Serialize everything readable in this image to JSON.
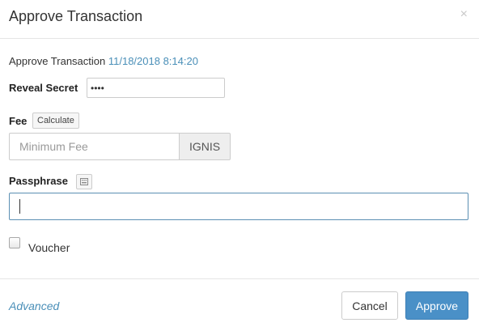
{
  "dialog": {
    "title": "Approve Transaction",
    "close_glyph": "×"
  },
  "info": {
    "label": "Approve Transaction",
    "timestamp": "11/18/2018 8:14:20"
  },
  "secret": {
    "label": "Reveal Secret",
    "value": "••••"
  },
  "fee": {
    "label": "Fee",
    "calculate_label": "Calculate",
    "placeholder": "Minimum Fee",
    "currency": "IGNIS"
  },
  "passphrase": {
    "label": "Passphrase",
    "value": "",
    "keyboard_icon": "keyboard-icon"
  },
  "voucher": {
    "label": "Voucher",
    "checked": false
  },
  "footer": {
    "advanced_label": "Advanced",
    "cancel_label": "Cancel",
    "approve_label": "Approve"
  },
  "colors": {
    "accent": "#4a90c7",
    "link": "#4a8fb8"
  }
}
